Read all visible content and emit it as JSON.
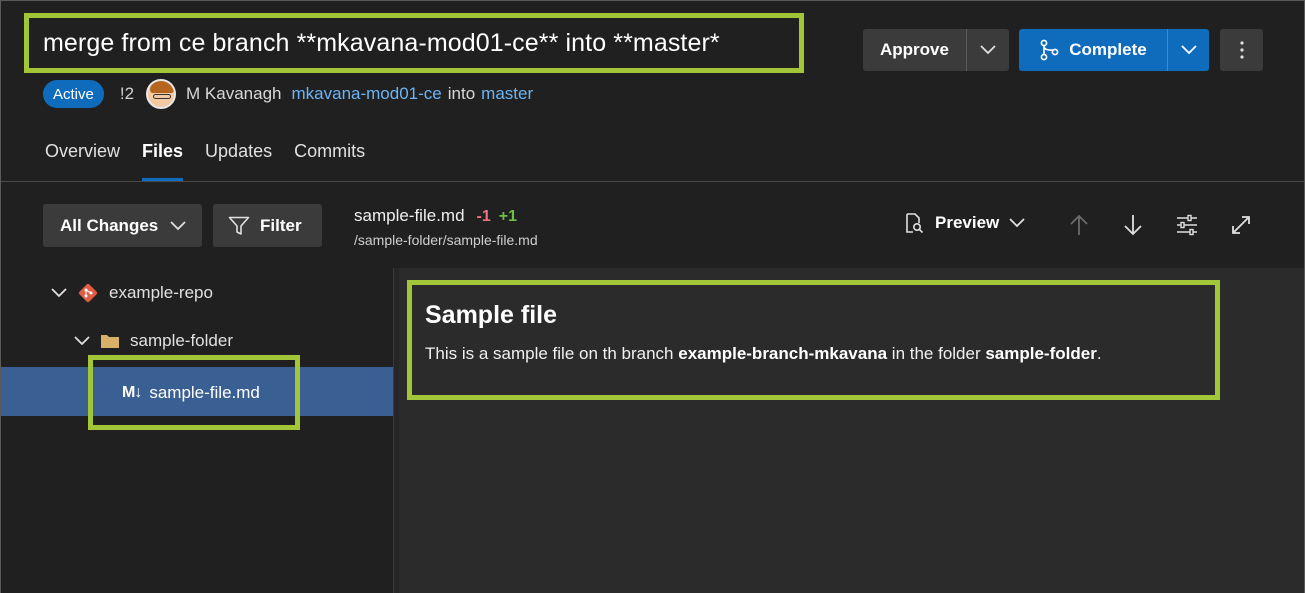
{
  "pr": {
    "title": "merge from ce branch **mkavana-mod01-ce** into **master*",
    "status": "Active",
    "id": "!2",
    "author": "M Kavanagh",
    "source_branch": "mkavana-mod01-ce",
    "into_text": "into",
    "target_branch": "master"
  },
  "actions": {
    "approve_label": "Approve",
    "complete_label": "Complete"
  },
  "tabs": [
    {
      "label": "Overview"
    },
    {
      "label": "Files"
    },
    {
      "label": "Updates"
    },
    {
      "label": "Commits"
    }
  ],
  "active_tab": "Files",
  "toolbar": {
    "all_changes_label": "All Changes",
    "filter_label": "Filter",
    "file_name": "sample-file.md",
    "deletions": "-1",
    "additions": "+1",
    "file_path": "/sample-folder/sample-file.md",
    "preview_label": "Preview"
  },
  "tree": {
    "repo": "example-repo",
    "folder": "sample-folder",
    "file_icon_text": "M↓",
    "file": "sample-file.md"
  },
  "preview": {
    "heading": "Sample file",
    "text_1": "This is a sample file on th branch ",
    "branch_bold": "example-branch-mkavana",
    "text_2": " in the folder ",
    "folder_bold": "sample-folder",
    "text_3": "."
  },
  "colors": {
    "accent_blue": "#0f6cbd",
    "highlight_green": "#a3c639",
    "link_blue": "#6cb4f5",
    "deletion_red": "#f1707b",
    "addition_green": "#6cc04a",
    "selected_row": "#3a5f93"
  }
}
